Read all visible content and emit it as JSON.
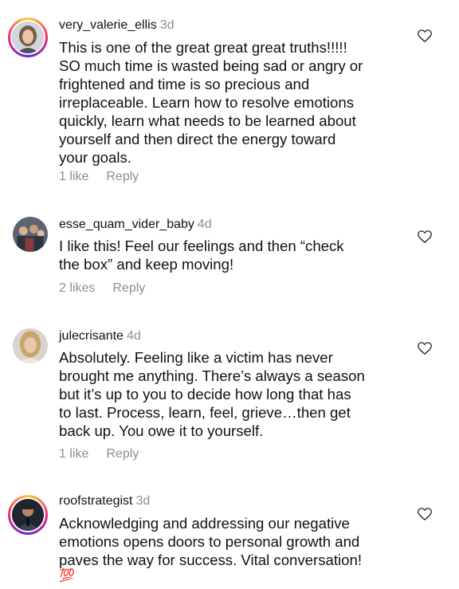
{
  "comments": [
    {
      "username": "very_valerie_ellis",
      "time": "3d",
      "lines": [
        "This is one of the great great great truths!!!!!",
        "SO much time is wasted being sad or angry or",
        "frightened and time is so precious and",
        "irreplaceable. Learn how to resolve emotions",
        "quickly, learn what needs to be learned about",
        "yourself and then direct the energy toward",
        "your goals."
      ],
      "likes": "1 like",
      "reply": "Reply"
    },
    {
      "username": "esse_quam_vider_baby",
      "time": "4d",
      "lines": [
        "I like this!  Feel our feelings and then “check",
        "the box” and keep moving!"
      ],
      "likes": "2 likes",
      "reply": "Reply"
    },
    {
      "username": "julecrisante",
      "time": "4d",
      "lines": [
        "Absolutely. Feeling like a victim has never",
        "brought me anything. There’s always a season",
        "but it’s up to you to decide how long that has",
        "to last. Process, learn, feel, grieve…then get",
        "back up. You owe it to yourself."
      ],
      "likes": "1 like",
      "reply": "Reply"
    },
    {
      "username": "roofstrategist",
      "time": "3d",
      "lines": [
        "Acknowledging and addressing our negative",
        "emotions opens doors to personal growth and",
        "paves the way for success. Vital conversation!",
        "💯"
      ]
    }
  ],
  "icons": {
    "like": "heart-outline-icon"
  },
  "colors": {
    "text": "#111111",
    "muted": "#8e8e8e",
    "story_ring": "#ee2a7b"
  }
}
